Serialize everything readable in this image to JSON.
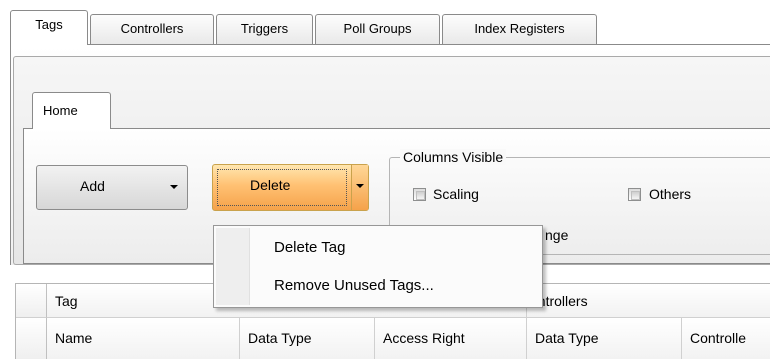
{
  "tabs": [
    {
      "label": "Tags",
      "active": true
    },
    {
      "label": "Controllers",
      "active": false
    },
    {
      "label": "Triggers",
      "active": false
    },
    {
      "label": "Poll Groups",
      "active": false
    },
    {
      "label": "Index Registers",
      "active": false
    }
  ],
  "ribbon": {
    "home_tab": "Home",
    "add_label": "Add",
    "delete_label": "Delete",
    "columns_group_title": "Columns Visible",
    "checkboxes": [
      {
        "label": "Scaling",
        "checked": false
      },
      {
        "label": "Others",
        "checked": false
      }
    ],
    "partial_label": "nge"
  },
  "menu": {
    "items": [
      "Delete Tag",
      "Remove Unused Tags..."
    ]
  },
  "grid": {
    "group_headers": [
      "Tag",
      "ontrollers"
    ],
    "columns": [
      "Name",
      "Data Type",
      "Access Right",
      "Data Type",
      "Controlle"
    ]
  },
  "colors": {
    "delete_accent": "#ffc173",
    "border": "#8a8a8a"
  }
}
